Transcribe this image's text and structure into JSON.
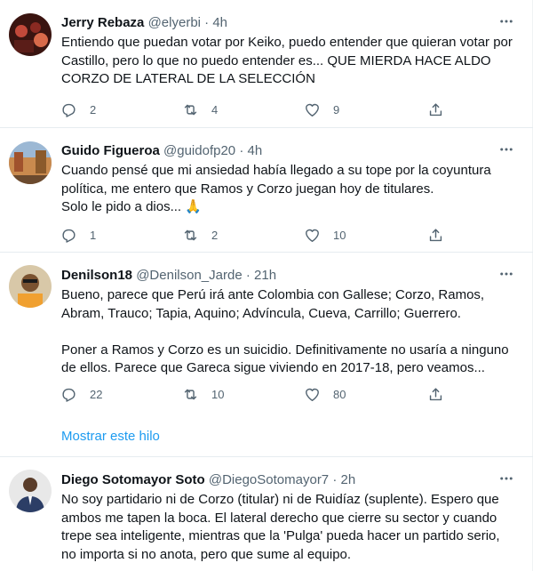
{
  "tweets": [
    {
      "name": "Jerry Rebaza",
      "handle": "@elyerbi",
      "dot": "·",
      "time": "4h",
      "text": "Entiendo que puedan votar por Keiko, puedo entender que quieran votar por Castillo, pero lo que no puedo entender es... QUE MIERDA HACE ALDO CORZO DE LATERAL DE LA SELECCIÓN",
      "replies": "2",
      "retweets": "4",
      "likes": "9"
    },
    {
      "name": "Guido Figueroa",
      "handle": "@guidofp20",
      "dot": "·",
      "time": "4h",
      "text": "Cuando pensé que mi ansiedad había llegado a su tope por la coyuntura política, me entero que Ramos y Corzo juegan hoy de titulares.\nSolo le pido a dios...",
      "emoji": "🙏",
      "replies": "1",
      "retweets": "2",
      "likes": "10"
    },
    {
      "name": "Denilson18",
      "handle": "@Denilson_Jarde",
      "dot": "·",
      "time": "21h",
      "text": "Bueno, parece que Perú irá ante Colombia con Gallese; Corzo, Ramos, Abram, Trauco; Tapia, Aquino; Advíncula, Cueva, Carrillo; Guerrero.\n\nPoner a Ramos y Corzo es un suicidio. Definitivamente no usaría a ninguno de ellos. Parece que Gareca sigue viviendo en 2017-18, pero veamos...",
      "replies": "22",
      "retweets": "10",
      "likes": "80",
      "show_thread": "Mostrar este hilo"
    },
    {
      "name": "Diego Sotomayor Soto",
      "handle": "@DiegoSotomayor7",
      "dot": "·",
      "time": "2h",
      "text": "No soy partidario ni de Corzo (titular) ni de Ruidíaz (suplente). Espero que ambos me tapen la boca. El lateral derecho que cierre su sector y cuando trepe sea inteligente, mientras que la 'Pulga' pueda hacer un partido serio, no importa si no anota, pero que sume al equipo."
    }
  ],
  "icons": {
    "reply": "reply-icon",
    "retweet": "retweet-icon",
    "like": "heart-icon",
    "share": "share-icon",
    "more": "more-icon"
  },
  "colors": {
    "text": "#0f1419",
    "secondary": "#536471",
    "link": "#1d9bf0",
    "divider": "#e6ecf0"
  }
}
